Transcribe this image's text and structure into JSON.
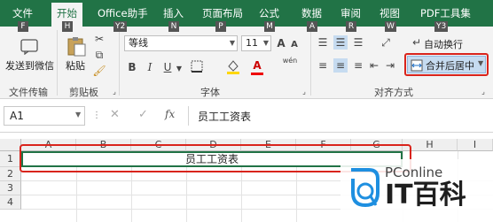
{
  "tabs": [
    {
      "label": "文件",
      "key": "F"
    },
    {
      "label": "开始",
      "key": "H",
      "active": true
    },
    {
      "label": "Office助手",
      "key": "Y2"
    },
    {
      "label": "插入",
      "key": "N"
    },
    {
      "label": "页面布局",
      "key": "P"
    },
    {
      "label": "公式",
      "key": "M"
    },
    {
      "label": "数据",
      "key": "A"
    },
    {
      "label": "审阅",
      "key": "R"
    },
    {
      "label": "视图",
      "key": "W"
    },
    {
      "label": "PDF工具集",
      "key": "Y3"
    }
  ],
  "ribbon": {
    "send_wechat": "发送到微信",
    "paste": "粘贴",
    "font_name": "等线",
    "font_size": "11",
    "wrap_text": "自动换行",
    "merge_center": "合并后居中",
    "groups": {
      "file_transfer": "文件传输",
      "clipboard": "剪贴板",
      "font": "字体",
      "alignment": "对齐方式"
    },
    "bold": "B",
    "italic": "I",
    "underline": "U",
    "grow_font": "A",
    "shrink_font": "A",
    "phonetic": "wén",
    "fx_btn": "A"
  },
  "formula_bar": {
    "name_box": "A1",
    "fx": "fx",
    "content": "员工工资表"
  },
  "sheet": {
    "columns": [
      "A",
      "B",
      "C",
      "D",
      "E",
      "F",
      "G",
      "H",
      "I"
    ],
    "rows": [
      "1",
      "2",
      "3",
      "4"
    ],
    "merged_cell_text": "员工工资表"
  },
  "watermark": {
    "brand_top": "PConline",
    "brand_bottom": "IT百科"
  },
  "colors": {
    "excel_green": "#217346",
    "highlight_red": "#d9241c"
  }
}
